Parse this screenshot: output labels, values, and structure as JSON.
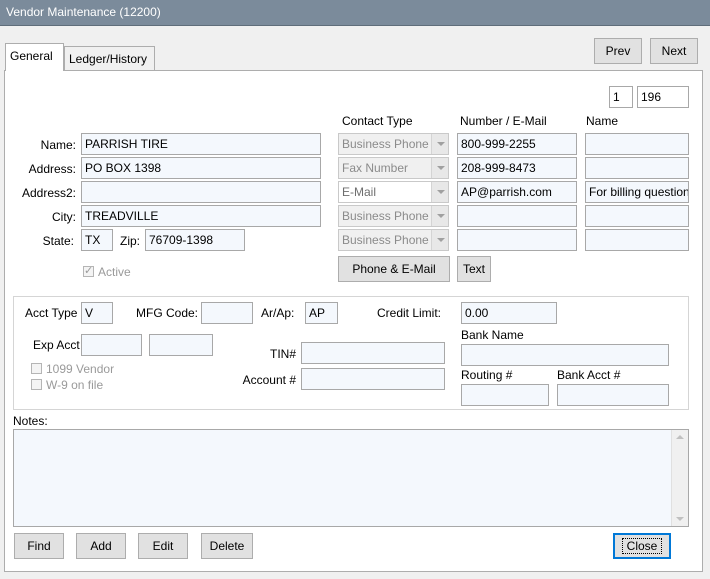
{
  "window": {
    "title": "Vendor Maintenance (12200)"
  },
  "tabs": [
    {
      "label": "General"
    },
    {
      "label": "Ledger/History"
    }
  ],
  "nav": {
    "prev": "Prev",
    "next": "Next"
  },
  "record": {
    "index": "1",
    "total": "196"
  },
  "contact_headers": {
    "type": "Contact Type",
    "number": "Number / E-Mail",
    "name": "Name"
  },
  "vendor": {
    "name_label": "Name:",
    "name": "PARRISH TIRE",
    "address_label": "Address:",
    "address": "PO BOX 1398",
    "address2_label": "Address2:",
    "address2": "",
    "city_label": "City:",
    "city": "TREADVILLE",
    "state_label": "State:",
    "state": "TX",
    "zip_label": "Zip:",
    "zip": "76709-1398",
    "active_label": "Active"
  },
  "contacts": [
    {
      "type": "Business Phone",
      "number": "800-999-2255",
      "name": ""
    },
    {
      "type": "Fax Number",
      "number": "208-999-8473",
      "name": ""
    },
    {
      "type": "E-Mail",
      "number": "AP@parrish.com",
      "name": "For billing questions"
    },
    {
      "type": "Business Phone",
      "number": "",
      "name": ""
    },
    {
      "type": "Business Phone",
      "number": "",
      "name": ""
    }
  ],
  "contact_buttons": {
    "phone_email": "Phone & E-Mail",
    "text": "Text"
  },
  "account": {
    "acct_type_label": "Acct Type",
    "acct_type": "V",
    "mfg_code_label": "MFG Code:",
    "mfg_code": "",
    "arap_label": "Ar/Ap:",
    "arap": "AP",
    "credit_limit_label": "Credit Limit:",
    "credit_limit": "0.00",
    "exp_acct_label": "Exp Acct",
    "exp_acct_1": "",
    "exp_acct_2": "",
    "vendor1099_label": "1099 Vendor",
    "w9_label": "W-9 on file",
    "tin_label": "TIN#",
    "tin": "",
    "account_no_label": "Account #",
    "account_no": "",
    "bank_name_label": "Bank Name",
    "bank_name": "",
    "routing_label": "Routing #",
    "routing": "",
    "bank_acct_label": "Bank Acct #",
    "bank_acct": ""
  },
  "notes": {
    "label": "Notes:",
    "value": ""
  },
  "actions": {
    "find": "Find",
    "add": "Add",
    "edit": "Edit",
    "delete": "Delete",
    "close": "Close"
  }
}
